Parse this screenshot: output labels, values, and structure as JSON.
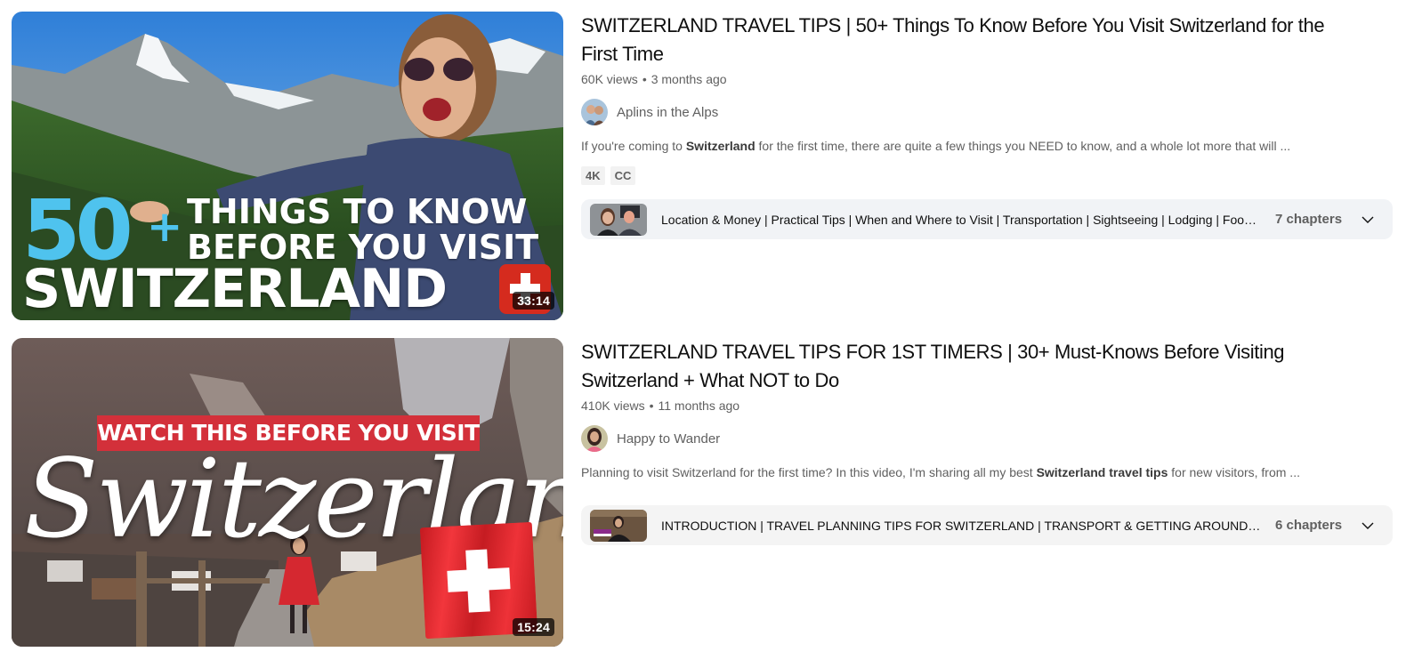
{
  "results": [
    {
      "title": "SWITZERLAND TRAVEL TIPS | 50+ Things To Know Before You Visit Switzerland for the First Time",
      "views": "60K views",
      "age": "3 months ago",
      "channel": "Aplins in the Alps",
      "description": {
        "pre": "If you're coming to ",
        "bold": "Switzerland",
        "post": " for the first time, there are quite a few things you NEED to know, and a whole lot more that will ..."
      },
      "badges": [
        "4K",
        "CC"
      ],
      "duration": "33:14",
      "thumbnail_text": {
        "number": "50",
        "plus": "+",
        "line1": "THINGS TO KNOW",
        "line2": "BEFORE YOU VISIT",
        "big": "SWITZERLAND"
      },
      "chapters_text": "Location & Money | Practical Tips | When and Where to Visit | Transportation | Sightseeing | Lodging | Food & Drink",
      "chapters_count": "7 chapters"
    },
    {
      "title": "SWITZERLAND TRAVEL TIPS FOR 1ST TIMERS | 30+ Must-Knows Before Visiting Switzerland + What NOT to Do",
      "views": "410K views",
      "age": "11 months ago",
      "channel": "Happy to Wander",
      "description": {
        "pre": "Planning to visit Switzerland for the first time? In this video, I'm sharing all my best ",
        "bold": "Switzerland travel tips",
        "post": " for new visitors, from ..."
      },
      "duration": "15:24",
      "thumbnail_text": {
        "banner": "WATCH THIS BEFORE YOU VISIT",
        "script": "Switzerland"
      },
      "chapters_text": "INTRODUCTION | TRAVEL PLANNING TIPS FOR SWITZERLAND | TRANSPORT & GETTING AROUND | ACCOMMODATION",
      "chapters_count": "6 chapters"
    }
  ],
  "separator": "•",
  "colors": {
    "chapter_bar_bg": "#f1f3f6",
    "secondary_text": "#606060",
    "badge_bg": "#f2f2f2",
    "swiss_red": "#d52b1e",
    "accent_blue": "#4fc3ee"
  }
}
